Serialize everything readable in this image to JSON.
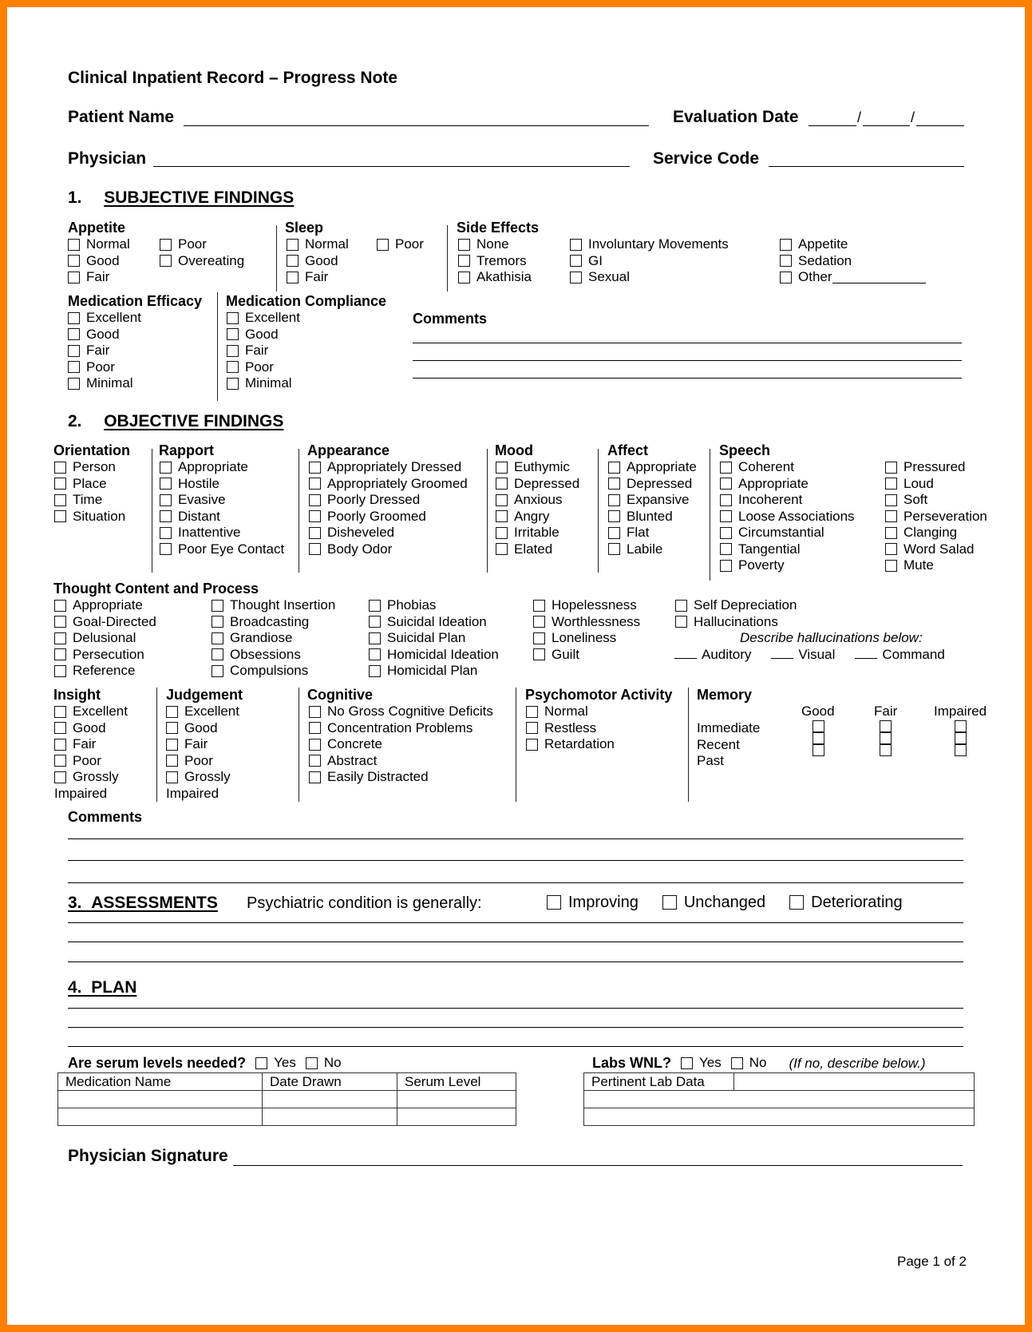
{
  "title": "Clinical Inpatient Record – Progress Note",
  "header": {
    "patient_name_label": "Patient Name",
    "evaluation_date_label": "Evaluation Date",
    "date_separator": "/",
    "physician_label": "Physician",
    "service_code_label": "Service Code"
  },
  "subjective": {
    "number": "1.",
    "heading": "SUBJECTIVE FINDINGS",
    "appetite": {
      "label": "Appetite",
      "col1": [
        "Normal",
        "Good",
        "Fair"
      ],
      "col2": [
        "Poor",
        "Overeating"
      ]
    },
    "sleep": {
      "label": "Sleep",
      "col1": [
        "Normal",
        "Good",
        "Fair"
      ],
      "col2": [
        "Poor"
      ]
    },
    "side_effects": {
      "label": "Side Effects",
      "col1": [
        "None",
        "Tremors",
        "Akathisia"
      ],
      "col2": [
        "Involuntary Movements",
        "GI",
        "Sexual"
      ],
      "col3": [
        "Appetite",
        "Sedation",
        "Other"
      ]
    },
    "medication_efficacy": {
      "label": "Medication Efficacy",
      "options": [
        "Excellent",
        "Good",
        "Fair",
        "Poor",
        "Minimal"
      ]
    },
    "medication_compliance": {
      "label": "Medication Compliance",
      "options": [
        "Excellent",
        "Good",
        "Fair",
        "Poor",
        "Minimal"
      ]
    },
    "comments_label": "Comments"
  },
  "objective": {
    "number": "2.",
    "heading": "OBJECTIVE FINDINGS",
    "orientation": {
      "label": "Orientation",
      "options": [
        "Person",
        "Place",
        "Time",
        "Situation"
      ]
    },
    "rapport": {
      "label": "Rapport",
      "options": [
        "Appropriate",
        "Hostile",
        "Evasive",
        "Distant",
        "Inattentive",
        "Poor Eye Contact"
      ]
    },
    "appearance": {
      "label": "Appearance",
      "options": [
        "Appropriately Dressed",
        "Appropriately Groomed",
        "Poorly Dressed",
        "Poorly Groomed",
        "Disheveled",
        "Body Odor"
      ]
    },
    "mood": {
      "label": "Mood",
      "options": [
        "Euthymic",
        "Depressed",
        "Anxious",
        "Angry",
        "Irritable",
        "Elated"
      ]
    },
    "affect": {
      "label": "Affect",
      "options": [
        "Appropriate",
        "Depressed",
        "Expansive",
        "Blunted",
        "Flat",
        "Labile"
      ]
    },
    "speech": {
      "label": "Speech",
      "col1": [
        "Coherent",
        "Appropriate",
        "Incoherent",
        "Loose Associations",
        "Circumstantial",
        "Tangential",
        "Poverty"
      ],
      "col2": [
        "Pressured",
        "Loud",
        "Soft",
        "Perseveration",
        "Clanging",
        "Word Salad",
        "Mute"
      ]
    },
    "thought": {
      "label": "Thought Content and Process",
      "col1": [
        "Appropriate",
        "Goal-Directed",
        "Delusional",
        "Persecution",
        "Reference"
      ],
      "col2": [
        "Thought Insertion",
        "Broadcasting",
        "Grandiose",
        "Obsessions",
        "Compulsions"
      ],
      "col3": [
        "Phobias",
        "Suicidal Ideation",
        "Suicidal Plan",
        "Homicidal Ideation",
        "Homicidal Plan"
      ],
      "col4": [
        "Hopelessness",
        "Worthlessness",
        "Loneliness",
        "Guilt"
      ],
      "col5": [
        "Self Depreciation",
        "Hallucinations"
      ],
      "hallucination_prompt": "Describe hallucinations below:",
      "hallucination_types": [
        "Auditory",
        "Visual",
        "Command"
      ]
    },
    "insight": {
      "label": "Insight",
      "options": [
        "Excellent",
        "Good",
        "Fair",
        "Poor",
        "Grossly"
      ],
      "continuation": "Impaired"
    },
    "judgement": {
      "label": "Judgement",
      "options": [
        "Excellent",
        "Good",
        "Fair",
        "Poor",
        "Grossly"
      ],
      "continuation": "Impaired"
    },
    "cognitive": {
      "label": "Cognitive",
      "options": [
        "No Gross Cognitive Deficits",
        "Concentration Problems",
        "Concrete",
        "Abstract",
        "Easily Distracted"
      ]
    },
    "psychomotor": {
      "label": "Psychomotor Activity",
      "options": [
        "Normal",
        "Restless",
        "Retardation"
      ]
    },
    "memory": {
      "label": "Memory",
      "columns": [
        "Good",
        "Fair",
        "Impaired"
      ],
      "rows": [
        "Immediate",
        "Recent",
        "Past"
      ]
    },
    "comments_label": "Comments"
  },
  "assessments": {
    "number": "3.",
    "heading": "ASSESSMENTS",
    "prompt": "Psychiatric condition is generally:",
    "options": [
      "Improving",
      "Unchanged",
      "Deteriorating"
    ]
  },
  "plan": {
    "number": "4.",
    "heading": "PLAN"
  },
  "serum": {
    "question": "Are serum levels needed?",
    "yes": "Yes",
    "no": "No",
    "columns": [
      "Medication Name",
      "Date Drawn",
      "Serum Level"
    ]
  },
  "labs": {
    "question": "Labs WNL?",
    "yes": "Yes",
    "no": "No",
    "note": "(If no, describe below.)",
    "columns": [
      "Pertinent Lab Data"
    ]
  },
  "signature_label": "Physician Signature",
  "page_indicator": "Page 1 of 2",
  "colors": {
    "border": "#ff8000"
  }
}
